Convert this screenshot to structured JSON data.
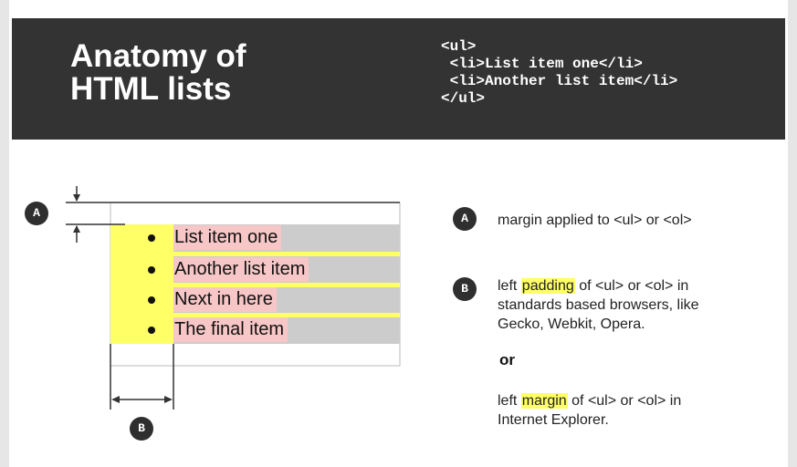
{
  "header": {
    "title_line1": "Anatomy of",
    "title_line2": "HTML lists",
    "code_lines": [
      "<ul>",
      " <li>List item one</li>",
      " <li>Another list item</li>",
      "</ul>"
    ]
  },
  "list_items": [
    "List item one",
    "Another list item",
    "Next in here",
    "The final item"
  ],
  "labels": {
    "a": "A",
    "b": "B"
  },
  "explanations": {
    "a_text": "margin applied to <ul> or <ol>",
    "b_prefix": "left ",
    "b_highlight": "padding",
    "b_suffix_line1": " of <ul> or <ol> in",
    "b_line2": "standards based browsers, like",
    "b_line3": "Gecko, Webkit, Opera.",
    "or": "or",
    "c_prefix": "left ",
    "c_highlight": "margin",
    "c_suffix_line1": " of <ul> or <ol> in",
    "c_line2": "Internet Explorer."
  },
  "colors": {
    "header_bg": "#333333",
    "padding_yellow": "#ffff66",
    "item_pink": "#f7c6c6",
    "item_gray": "#cccccc",
    "badge": "#2f2f2f"
  }
}
